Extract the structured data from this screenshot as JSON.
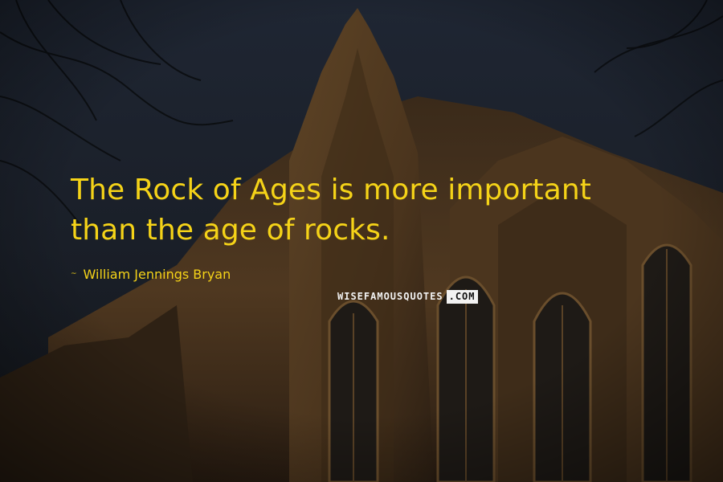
{
  "quote": {
    "line1": "The Rock of Ages is more important",
    "line2": "than the age of rocks."
  },
  "author": {
    "dash": "~",
    "name": "William Jennings Bryan"
  },
  "watermark": {
    "main": "WISEFAMOUSQUOTES",
    "suffix": ".COM"
  },
  "colors": {
    "quote_text": "#f5d318",
    "sky": "#1a2230",
    "brick": "#5a4024"
  }
}
